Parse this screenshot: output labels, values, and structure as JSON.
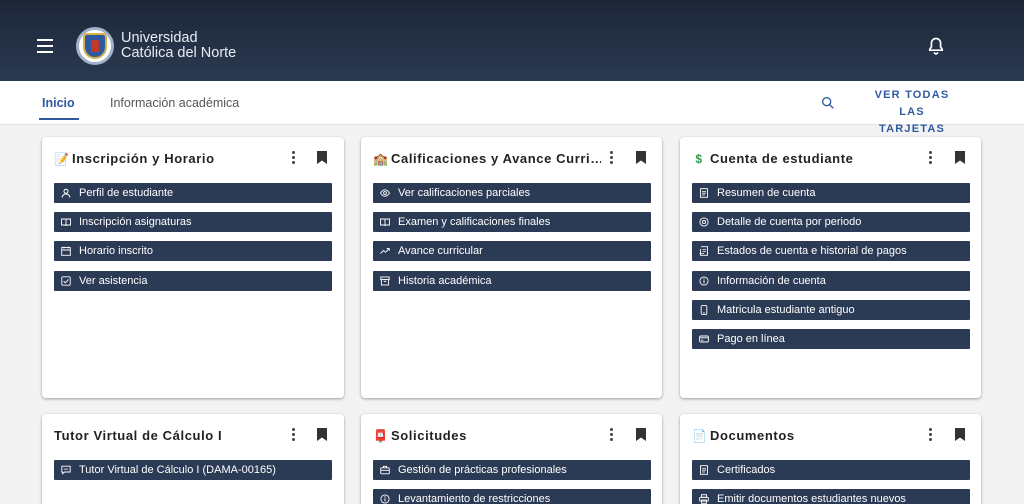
{
  "header": {
    "brand_line1": "Universidad",
    "brand_line2": "Católica del Norte"
  },
  "nav": {
    "tabs": [
      {
        "label": "Inicio",
        "active": true
      },
      {
        "label": "Información académica",
        "active": false
      }
    ],
    "all_cards_line1": "VER TODAS LAS",
    "all_cards_line2": "TARJETAS"
  },
  "cards": [
    {
      "title": "Inscripción y Horario",
      "title_icon": "📝",
      "links": [
        "Perfil de estudiante",
        "Inscripción asignaturas",
        "Horario inscrito",
        "Ver asistencia"
      ],
      "icons": [
        "user-icon",
        "book-icon",
        "calendar-icon",
        "checkbox-icon"
      ]
    },
    {
      "title": "Calificaciones y Avance Curri…",
      "title_icon": "🏫",
      "links": [
        "Ver calificaciones parciales",
        "Examen y calificaciones finales",
        "Avance curricular",
        "Historia académica"
      ],
      "icons": [
        "eye-icon",
        "book-icon",
        "trend-icon",
        "archive-icon"
      ]
    },
    {
      "title": "Cuenta de estudiante",
      "title_icon": "$",
      "links": [
        "Resumen de cuenta",
        "Detalle de cuenta por periodo",
        "Estados de cuenta e historial de pagos",
        "Información de cuenta",
        "Matricula estudiante antiguo",
        "Pago en línea"
      ],
      "icons": [
        "document-icon",
        "target-icon",
        "receipt-icon",
        "info-icon",
        "phone-icon",
        "payment-icon"
      ]
    },
    {
      "title": "Tutor Virtual de Cálculo I",
      "title_icon": "",
      "links": [
        "Tutor Virtual de Cálculo I (DAMA-00165)"
      ],
      "icons": [
        "chat-icon"
      ]
    },
    {
      "title": "Solicitudes",
      "title_icon": "📮",
      "links": [
        "Gestión de prácticas profesionales",
        "Levantamiento de restricciones"
      ],
      "icons": [
        "briefcase-icon",
        "info-icon"
      ]
    },
    {
      "title": "Documentos",
      "title_icon": "📄",
      "links": [
        "Certificados",
        "Emitir documentos estudiantes nuevos"
      ],
      "icons": [
        "document-icon",
        "print-icon"
      ]
    }
  ]
}
